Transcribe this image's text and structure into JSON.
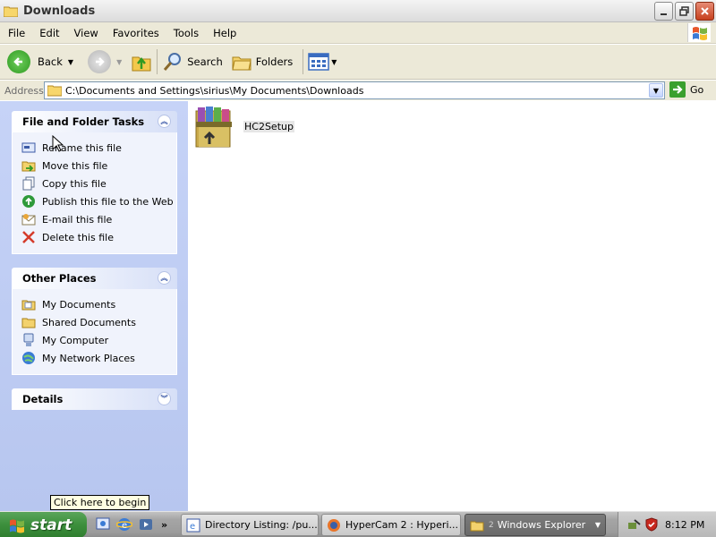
{
  "window": {
    "title": "Downloads"
  },
  "menu": {
    "items": [
      "File",
      "Edit",
      "View",
      "Favorites",
      "Tools",
      "Help"
    ]
  },
  "toolbar": {
    "back_label": "Back",
    "search_label": "Search",
    "folders_label": "Folders"
  },
  "address": {
    "label": "Address",
    "value": "C:\\Documents and Settings\\sirius\\My Documents\\Downloads",
    "go_label": "Go"
  },
  "file_tasks": {
    "title": "File and Folder Tasks",
    "items": [
      {
        "label": "Rename this file",
        "icon": "rename-icon"
      },
      {
        "label": "Move this file",
        "icon": "move-icon"
      },
      {
        "label": "Copy this file",
        "icon": "copy-icon"
      },
      {
        "label": "Publish this file to the Web",
        "icon": "publish-icon"
      },
      {
        "label": "E-mail this file",
        "icon": "email-icon"
      },
      {
        "label": "Delete this file",
        "icon": "delete-icon"
      }
    ]
  },
  "other_places": {
    "title": "Other Places",
    "items": [
      {
        "label": "My Documents",
        "icon": "my-documents-icon"
      },
      {
        "label": "Shared Documents",
        "icon": "folder-icon"
      },
      {
        "label": "My Computer",
        "icon": "computer-icon"
      },
      {
        "label": "My Network Places",
        "icon": "network-icon"
      }
    ]
  },
  "details": {
    "title": "Details"
  },
  "files": [
    {
      "name": "HC2Setup",
      "icon": "winrar-archive-icon",
      "selected": true
    }
  ],
  "tooltip": "Click here to begin",
  "taskbar": {
    "start_label": "start",
    "tasks": [
      {
        "label": "Directory Listing: /pu...",
        "active": false
      },
      {
        "label": "HyperCam 2 : Hyperi...",
        "active": false
      },
      {
        "label": "Windows Explorer",
        "active": true
      }
    ],
    "clock": "8:12 PM"
  },
  "colors": {
    "sidebar_bg": "#c6d3f7",
    "panel_title": "#215dc6",
    "taskbar_start": "#3c8f3c",
    "close_button": "#c7401e"
  }
}
